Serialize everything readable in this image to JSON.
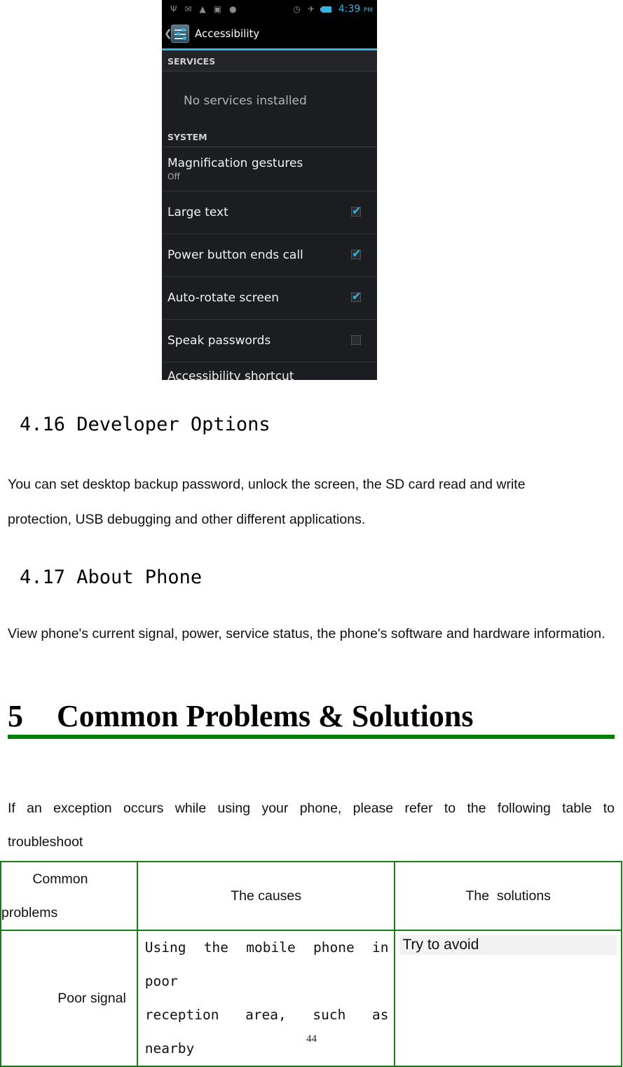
{
  "phone": {
    "status_bar": {
      "left_icons": [
        "usb-icon",
        "gmail-icon",
        "warning-icon",
        "message-icon",
        "android-icon"
      ],
      "right_icons": [
        "alarm-icon",
        "airplane-mode-icon",
        "battery-charging-icon"
      ],
      "time": "4:39",
      "ampm": "PM"
    },
    "action_bar": {
      "back_glyph": "❮",
      "title": "Accessibility"
    },
    "sections": {
      "services": "SERVICES",
      "services_empty": "No services installed",
      "system": "SYSTEM"
    },
    "items": [
      {
        "title": "Magnification gestures",
        "summary": "Off"
      },
      {
        "title": "Large text",
        "checked": true
      },
      {
        "title": "Power button ends call",
        "checked": true
      },
      {
        "title": "Auto-rotate screen",
        "checked": true
      },
      {
        "title": "Speak passwords",
        "checked": false
      },
      {
        "title": "Accessibility shortcut"
      }
    ],
    "accent_color": "#33b5e5"
  },
  "doc": {
    "sec_4_16": {
      "heading": "4.16 Developer Options",
      "line1": "You can set desktop backup password, unlock the screen, the SD card read and write",
      "line2": "protection, USB debugging and other different applications."
    },
    "sec_4_17": {
      "heading": "4.17 About Phone",
      "body": "View phone's current signal, power, service status, the phone's software and hardware information."
    },
    "chapter_5": {
      "number": "5",
      "title": "Common Problems & Solutions",
      "rule_color": "#008000",
      "intro_line1": "If an exception occurs while using your phone, please refer to the following table to",
      "intro_line2": "troubleshoot"
    },
    "table": {
      "headers": {
        "problems_line1": "Common",
        "problems_line2": "problems",
        "causes": "The causes",
        "solutions": "The  solutions"
      },
      "rows": [
        {
          "problem": "Poor signal",
          "cause_line1": "Using the mobile phone in poor",
          "cause_line2": "reception area, such as nearby",
          "solution": "Try to avoid"
        }
      ]
    },
    "page_number": "44"
  }
}
